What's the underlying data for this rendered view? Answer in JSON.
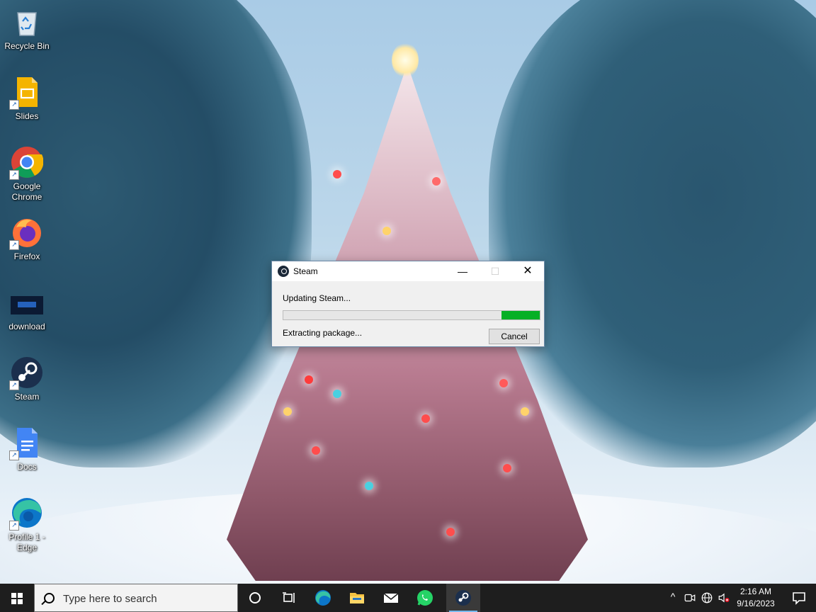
{
  "desktop": {
    "icons": [
      {
        "label": "Recycle Bin",
        "icon": "recycle-bin-icon"
      },
      {
        "label": "Slides",
        "icon": "google-slides-icon"
      },
      {
        "label": "Google Chrome",
        "icon": "chrome-icon"
      },
      {
        "label": "Firefox",
        "icon": "firefox-icon"
      },
      {
        "label": "download",
        "icon": "image-file-icon"
      },
      {
        "label": "Steam",
        "icon": "steam-icon"
      },
      {
        "label": "Docs",
        "icon": "google-docs-icon"
      },
      {
        "label": "Profile 1 - Edge",
        "icon": "edge-icon"
      }
    ]
  },
  "dialog": {
    "title": "Steam",
    "status_top": "Updating Steam...",
    "status_bottom": "Extracting package...",
    "progress_fraction": 0.15,
    "progress_start_fraction": 0.85,
    "cancel_label": "Cancel"
  },
  "taskbar": {
    "search_placeholder": "Type here to search",
    "pinned": [
      "cortana-icon",
      "task-view-icon",
      "edge-icon",
      "file-explorer-icon",
      "mail-icon",
      "whatsapp-icon",
      "steam-icon"
    ],
    "active_app": "steam-icon",
    "clock": {
      "time": "2:16 AM",
      "date": "9/16/2023"
    }
  },
  "colors": {
    "progress_green": "#06b025",
    "taskbar": "#1e1e1e",
    "accent_blue": "#76b9ed"
  }
}
